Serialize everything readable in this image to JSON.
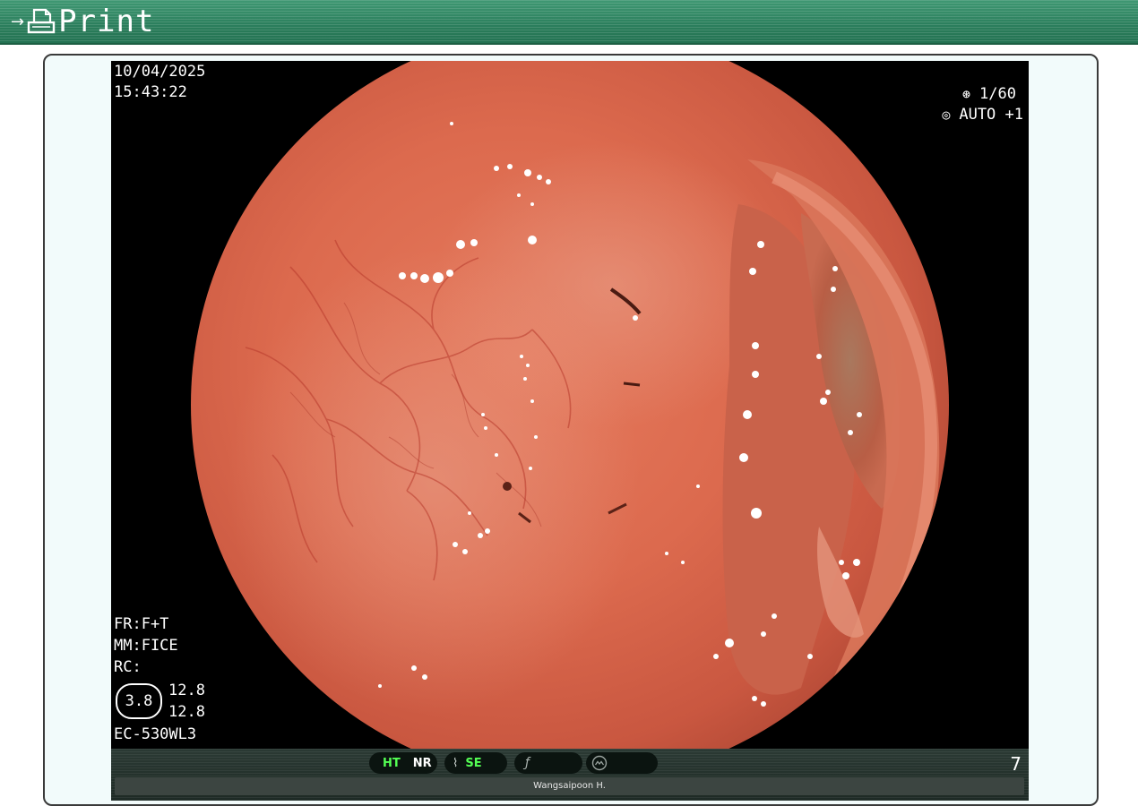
{
  "header": {
    "print_label": "Print",
    "arrow_icon": "→",
    "accent_color": "#2b7e5c"
  },
  "image": {
    "date": "10/04/2025",
    "time": "15:43:22",
    "shutter": "1/60",
    "exposure": "AUTO +1",
    "fr": "FR:F+T",
    "mm": "MM:FICE",
    "rc": "RC:",
    "zoom": "3.8",
    "enhance_a": "12.8",
    "enhance_b": "12.8",
    "scope": "EC-530WL3"
  },
  "status_bar": {
    "ht": "HT",
    "nr": "NR",
    "se": "SE",
    "f_symbol": "ƒ",
    "frame_number": "7",
    "operator": "Wangsaipoon H."
  }
}
